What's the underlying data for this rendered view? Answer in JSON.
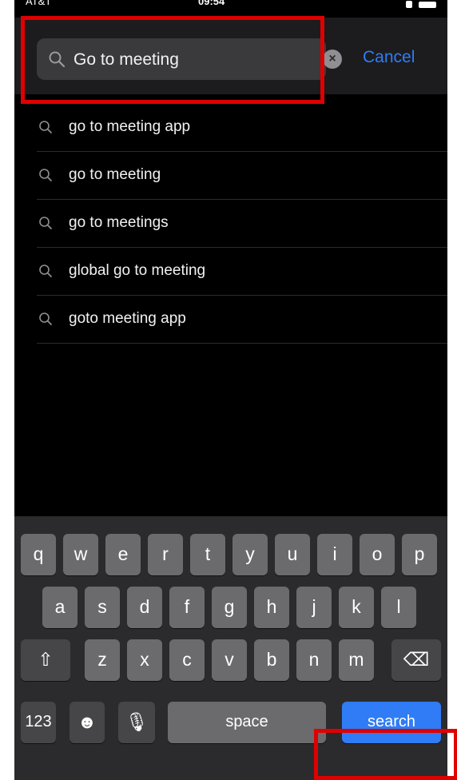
{
  "status": {
    "carrier": "AT&T",
    "time": "09:54"
  },
  "search": {
    "value": "Go to meeting",
    "clear_label": "×",
    "cancel_label": "Cancel"
  },
  "suggestions": [
    "go to meeting app",
    "go to meeting",
    "go to meetings",
    "global go to meeting",
    "goto meeting app"
  ],
  "keyboard": {
    "row1": [
      "q",
      "w",
      "e",
      "r",
      "t",
      "y",
      "u",
      "i",
      "o",
      "p"
    ],
    "row2": [
      "a",
      "s",
      "d",
      "f",
      "g",
      "h",
      "j",
      "k",
      "l"
    ],
    "row3": [
      "z",
      "x",
      "c",
      "v",
      "b",
      "n",
      "m"
    ],
    "shift": "⇧",
    "backspace": "⌫",
    "numbers": "123",
    "emoji": "☻",
    "mic": "🎙",
    "space": "space",
    "search": "search"
  },
  "colors": {
    "accent": "#2f7cf6",
    "highlight": "#e00000"
  }
}
